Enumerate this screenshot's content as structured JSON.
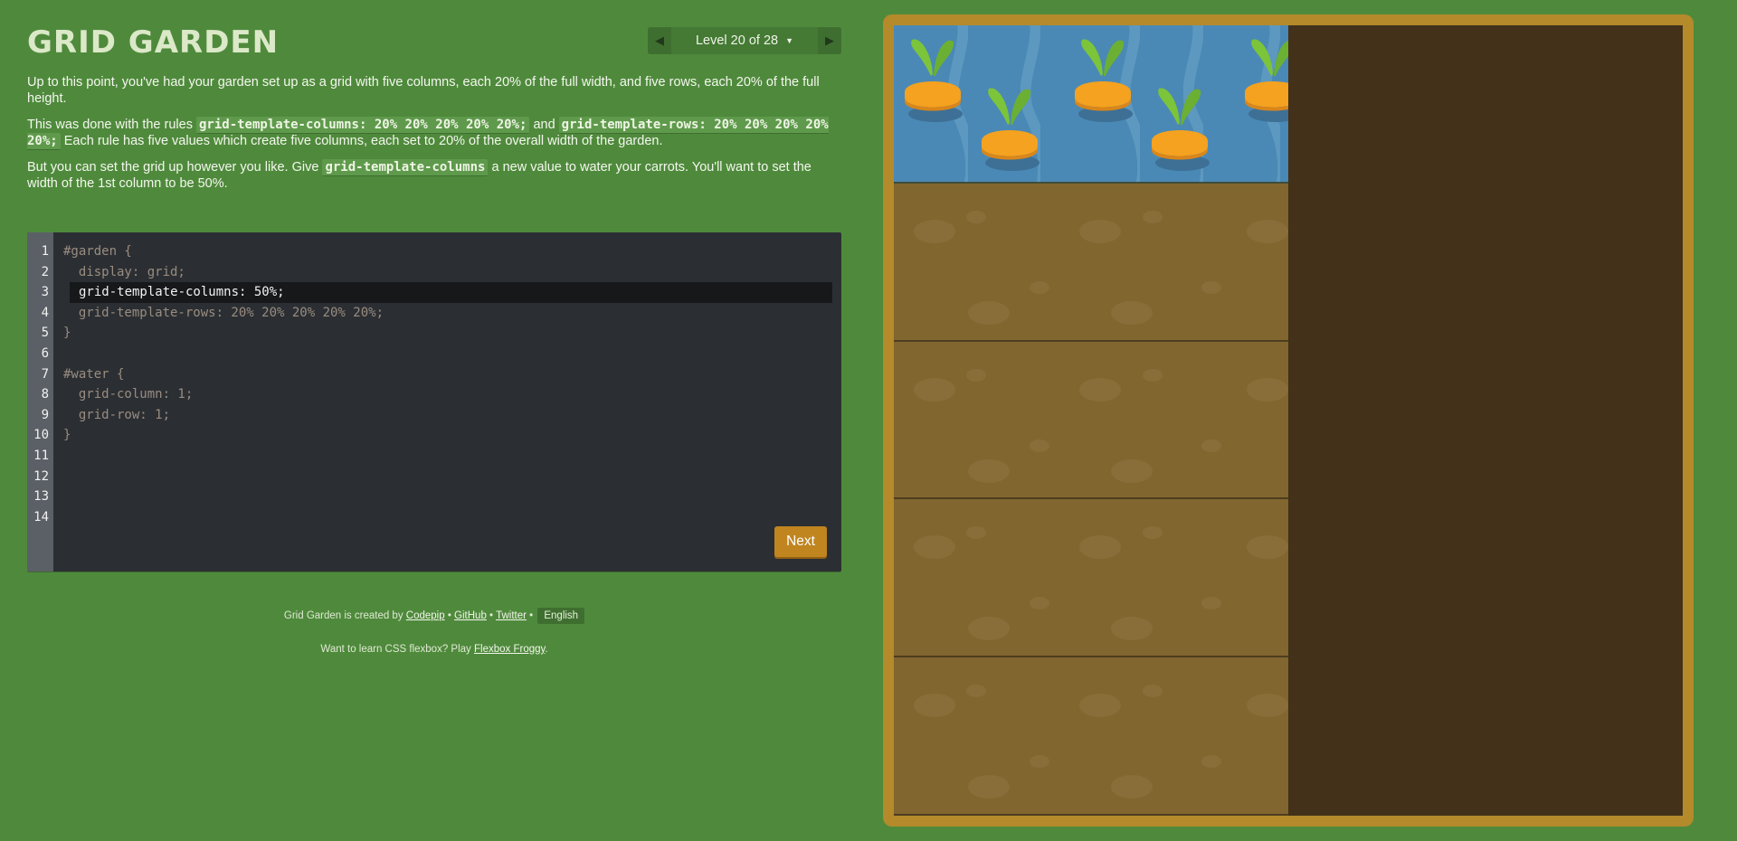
{
  "app": {
    "title": "GRID GARDEN"
  },
  "level_nav": {
    "label": "Level 20 of 28",
    "prev_icon": "triangle-left",
    "next_icon": "triangle-right"
  },
  "instructions": {
    "p1": "Up to this point, you've had your garden set up as a grid with five columns, each 20% of the full width, and five rows, each 20% of the full height.",
    "p2_a": "This was done with the rules ",
    "p2_code1": "grid-template-columns: 20% 20% 20% 20% 20%;",
    "p2_b": " and ",
    "p2_code2": "grid-template-rows: 20% 20% 20% 20% 20%;",
    "p2_c": " Each rule has five values which create five columns, each set to 20% of the overall width of the garden.",
    "p3_a": "But you can set the grid up however you like. Give ",
    "p3_code": "grid-template-columns",
    "p3_b": " a new value to water your carrots. You'll want to set the width of the 1st column to be 50%."
  },
  "editor": {
    "line_numbers": [
      "1",
      "2",
      "3",
      "4",
      "5",
      "6",
      "7",
      "8",
      "9",
      "10",
      "11",
      "12",
      "13",
      "14"
    ],
    "lines": {
      "l1": "#garden {",
      "l2": "  display: grid;",
      "l3_input": "grid-template-columns: 50%;",
      "l4": "  grid-template-rows: 20% 20% 20% 20% 20%;",
      "l5": "}",
      "l7": "#water {",
      "l8": "  grid-column: 1;",
      "l9": "  grid-row: 1;",
      "l10": "}"
    },
    "next_label": "Next"
  },
  "credits": {
    "created_by": "Grid Garden is created by ",
    "codepip": "Codepip",
    "sep": " • ",
    "github": "GitHub",
    "twitter": "Twitter",
    "language": "English",
    "row2_a": "Want to learn CSS flexbox? Play ",
    "flexbox_froggy": "Flexbox Froggy",
    "row2_b": "."
  },
  "garden": {
    "columns": "50%",
    "rows": "20% 20% 20% 20% 20%",
    "water": {
      "column": 1,
      "row": 1
    },
    "colors": {
      "water": "#4a89b5",
      "soil": "#826630",
      "bed": "#43311a",
      "frame": "#b48a2b",
      "carrot": "#f4a21f",
      "leaf": "#7cc43a"
    }
  }
}
